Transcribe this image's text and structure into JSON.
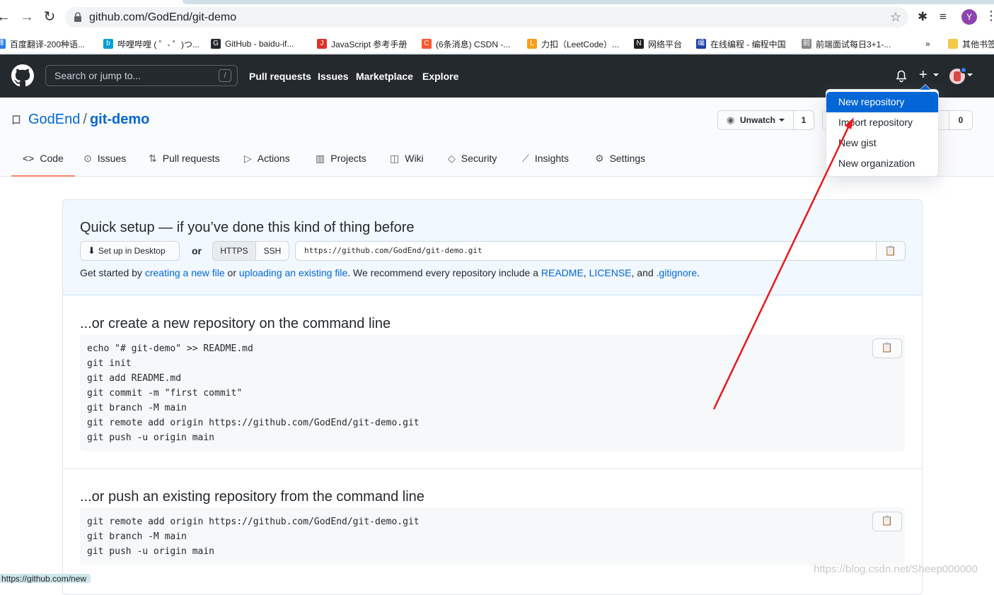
{
  "browser": {
    "url": "github.com/GodEnd/git-demo",
    "profile_initial": "Y",
    "bookmarks": [
      {
        "label": "百度翻译-200种语...",
        "icon_color": "#2b7de9",
        "icon_char": "译"
      },
      {
        "label": "哔哩哔哩 ( ゜- ゜)つ...",
        "icon_color": "#00a1d6",
        "icon_char": "b"
      },
      {
        "label": "GitHub - baidu-if...",
        "icon_color": "#24292e",
        "icon_char": "G"
      },
      {
        "label": "JavaScript 参考手册",
        "icon_color": "#d9342b",
        "icon_char": "J"
      },
      {
        "label": "(6条消息) CSDN -...",
        "icon_color": "#fc5531",
        "icon_char": "C"
      },
      {
        "label": "力扣（LeetCode）...",
        "icon_color": "#f89f1b",
        "icon_char": "L"
      },
      {
        "label": "网络平台",
        "icon_color": "#222222",
        "icon_char": "N"
      },
      {
        "label": "在线编程 - 编程中国",
        "icon_color": "#1a3fa8",
        "icon_char": "编"
      },
      {
        "label": "前端面试每日3+1-...",
        "icon_color": "#8a8a8a",
        "icon_char": "前"
      }
    ],
    "more_bookmarks": "»",
    "other_bookmarks": "其他书签",
    "status_url": "https://github.com/new"
  },
  "header": {
    "search_placeholder": "Search or jump to...",
    "search_shortcut": "/",
    "nav": [
      "Pull requests",
      "Issues",
      "Marketplace",
      "Explore"
    ]
  },
  "repo": {
    "owner": "GodEnd",
    "separator": "/",
    "name": "git-demo",
    "watch_label": "Unwatch",
    "watch_count": "1",
    "star_count": "0",
    "tabs": [
      {
        "label": "Code",
        "icon": "code-icon",
        "glyph": "<>"
      },
      {
        "label": "Issues",
        "icon": "issue-icon",
        "glyph": "⊙"
      },
      {
        "label": "Pull requests",
        "icon": "pull-request-icon",
        "glyph": "⇅"
      },
      {
        "label": "Actions",
        "icon": "play-icon",
        "glyph": "▷"
      },
      {
        "label": "Projects",
        "icon": "project-icon",
        "glyph": "▥"
      },
      {
        "label": "Wiki",
        "icon": "book-icon",
        "glyph": "◫"
      },
      {
        "label": "Security",
        "icon": "shield-icon",
        "glyph": "◇"
      },
      {
        "label": "Insights",
        "icon": "graph-icon",
        "glyph": "⟋"
      },
      {
        "label": "Settings",
        "icon": "gear-icon",
        "glyph": "⚙"
      }
    ]
  },
  "dropdown": {
    "items": [
      "New repository",
      "Import repository",
      "New gist",
      "New organization"
    ]
  },
  "quick_setup": {
    "title": "Quick setup — if you’ve done this kind of thing before",
    "desktop_button": "Set up in Desktop",
    "or": "or",
    "https": "HTTPS",
    "ssh": "SSH",
    "clone_url": "https://github.com/GodEnd/git-demo.git",
    "get_started": {
      "t1": "Get started by ",
      "link1": "creating a new file",
      "t2": " or ",
      "link2": "uploading an existing file",
      "t3": ". We recommend every repository include a ",
      "link3": "README",
      "t4": ", ",
      "link4": "LICENSE",
      "t5": ", and ",
      "link5": ".gitignore",
      "t6": "."
    }
  },
  "create_section": {
    "title": "...or create a new repository on the command line",
    "lines": [
      "echo \"# git-demo\" >> README.md",
      "git init",
      "git add README.md",
      "git commit -m \"first commit\"",
      "git branch -M main",
      "git remote add origin https://github.com/GodEnd/git-demo.git",
      "git push -u origin main"
    ]
  },
  "push_section": {
    "title": "...or push an existing repository from the command line",
    "lines": [
      "git remote add origin https://github.com/GodEnd/git-demo.git",
      "git branch -M main",
      "git push -u origin main"
    ]
  },
  "watermark": "https://blog.csdn.net/Sheep000000",
  "colors": {
    "header_bg": "#24292e",
    "link": "#0366d6",
    "active_tab": "#f9826c",
    "annotation_arrow": "#e8191c"
  }
}
